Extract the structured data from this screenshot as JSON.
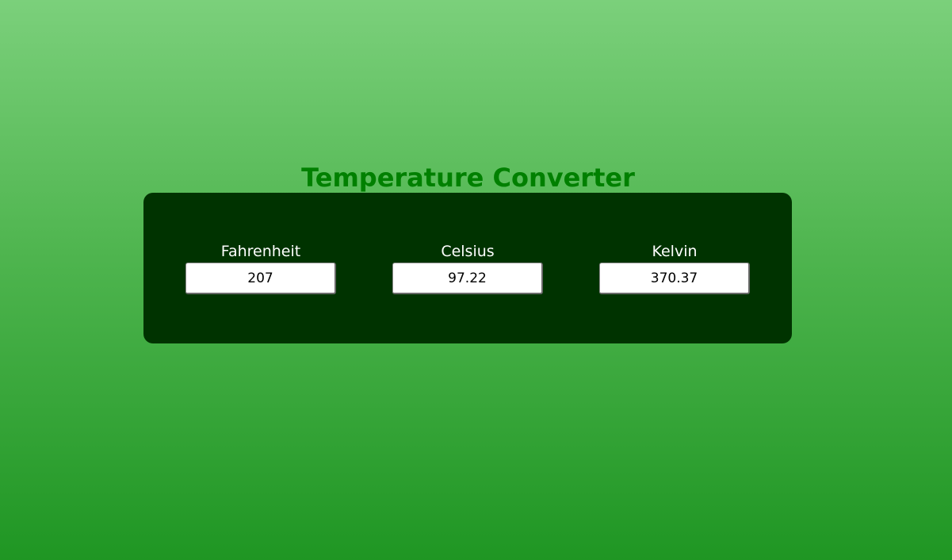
{
  "header": {
    "title": "Temperature Converter"
  },
  "converter": {
    "fahrenheit": {
      "label": "Fahrenheit",
      "value": "207"
    },
    "celsius": {
      "label": "Celsius",
      "value": "97.22"
    },
    "kelvin": {
      "label": "Kelvin",
      "value": "370.37"
    }
  },
  "colors": {
    "title": "#008000",
    "panel_background": "#003300",
    "label_text": "#ffffff",
    "background_top": "#7bd07b",
    "background_bottom": "#1f9623"
  }
}
